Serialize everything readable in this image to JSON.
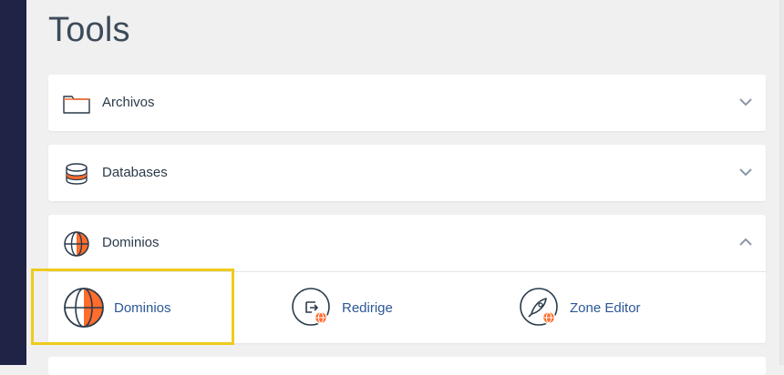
{
  "page": {
    "title": "Tools"
  },
  "colors": {
    "accent": "#ff6c2c",
    "rail": "#1f2346",
    "highlight": "#eecb1c",
    "link": "#2b5797"
  },
  "sections": [
    {
      "label": "Archivos",
      "icon": "folder-icon",
      "state": "collapsed"
    },
    {
      "label": "Databases",
      "icon": "database-icon",
      "state": "collapsed"
    },
    {
      "label": "Dominios",
      "icon": "globe-icon",
      "state": "expanded",
      "tools": [
        {
          "label": "Dominios",
          "icon": "globe-icon"
        },
        {
          "label": "Redirige",
          "icon": "redirect-icon"
        },
        {
          "label": "Zone Editor",
          "icon": "rocket-icon"
        }
      ]
    }
  ]
}
